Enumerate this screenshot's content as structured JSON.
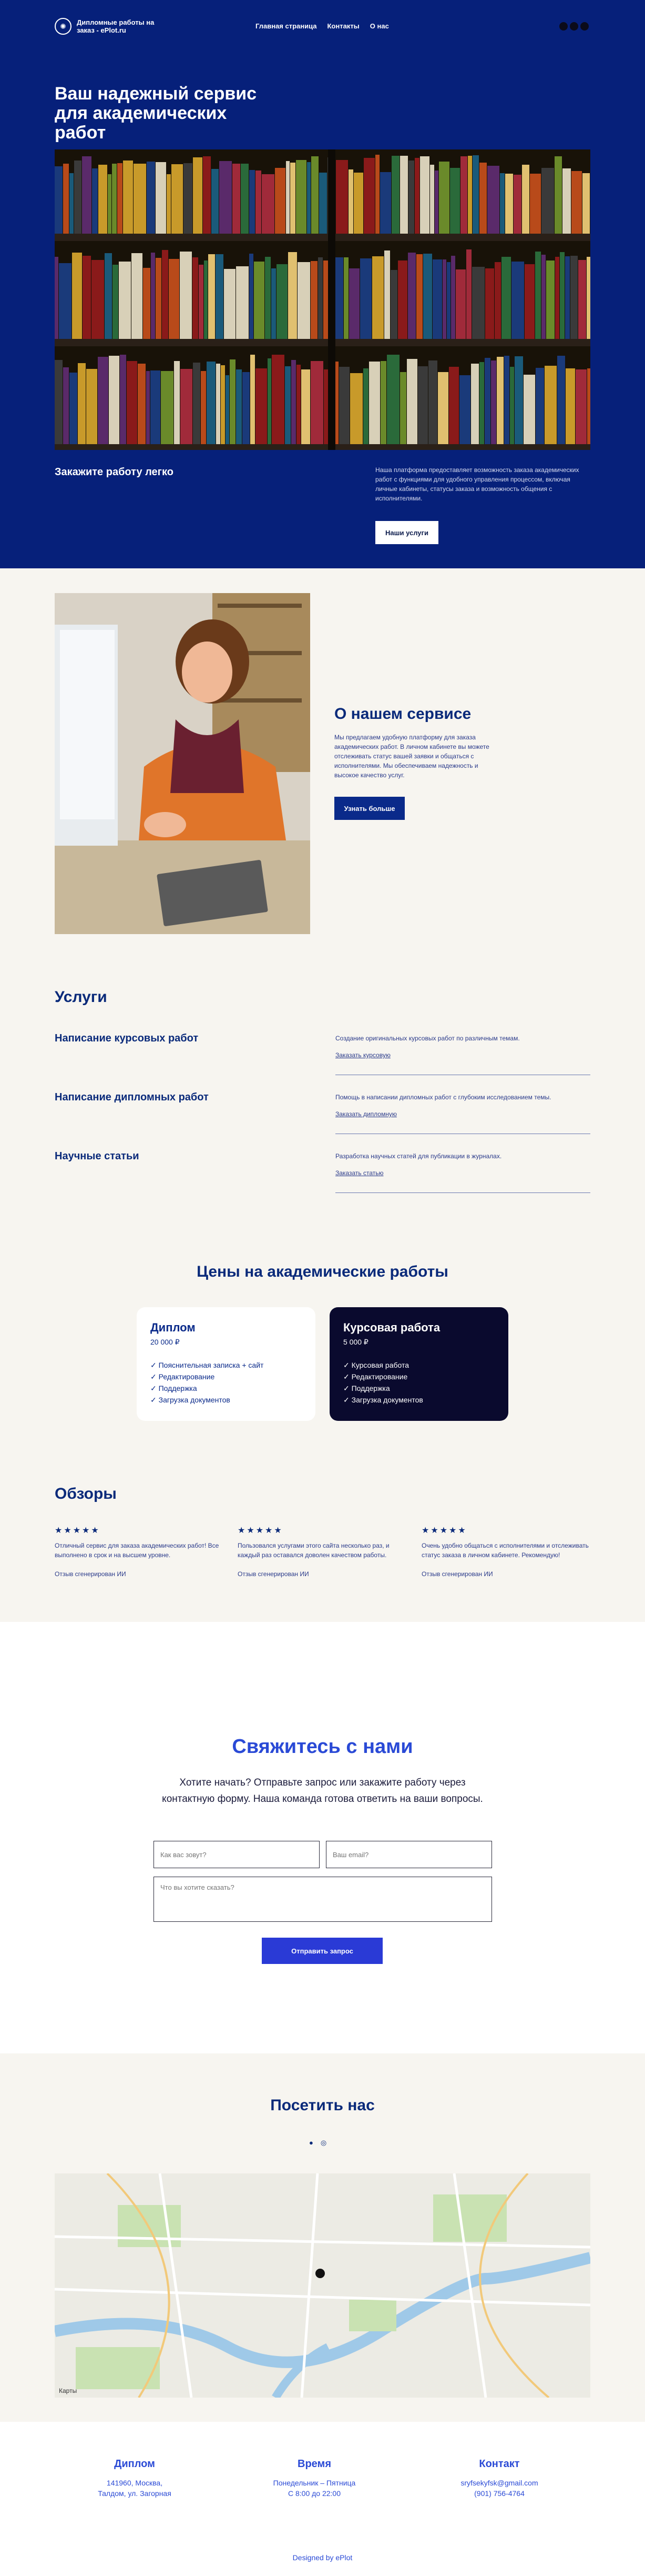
{
  "header": {
    "brand": "Дипломные работы на заказ - ePlot.ru",
    "nav": [
      "Главная страница",
      "Контакты",
      "О нас"
    ]
  },
  "hero": {
    "title": "Ваш надежный сервис для академических работ",
    "subtitle": "Закажите работу легко",
    "description": "Наша платформа предоставляет возможность заказа академических работ с функциями для удобного управления процессом, включая личные кабинеты, статусы заказа и возможность общения с исполнителями.",
    "button": "Наши услуги"
  },
  "about": {
    "title": "О нашем сервисе",
    "description": "Мы предлагаем удобную платформу для заказа академических работ. В личном кабинете вы можете отслеживать статус вашей заявки и общаться с исполнителями. Мы обеспечиваем надежность и высокое качество услуг.",
    "button": "Узнать больше"
  },
  "services": {
    "title": "Услуги",
    "items": [
      {
        "name": "Написание курсовых работ",
        "desc": "Создание оригинальных курсовых работ по различным темам.",
        "link": "Заказать курсовую"
      },
      {
        "name": "Написание дипломных работ",
        "desc": "Помощь в написании дипломных работ с глубоким исследованием темы.",
        "link": "Заказать дипломную"
      },
      {
        "name": "Научные статьи",
        "desc": "Разработка научных статей для публикации в журналах.",
        "link": "Заказать статью"
      }
    ]
  },
  "prices": {
    "title": "Цены на академические работы",
    "cards": [
      {
        "name": "Диплом",
        "price": "20 000 ₽",
        "features": [
          "✓ Пояснительная записка + сайт",
          "✓ Редактирование",
          "✓ Поддержка",
          "✓ Загрузка документов"
        ]
      },
      {
        "name": "Курсовая работа",
        "price": "5 000 ₽",
        "features": [
          "✓ Курсовая работа",
          "✓ Редактирование",
          "✓ Поддержка",
          "✓ Загрузка документов"
        ]
      }
    ]
  },
  "reviews": {
    "title": "Обзоры",
    "items": [
      {
        "stars": "★★★★★",
        "text": "Отличный сервис для заказа академических работ! Все выполнено в срок и на высшем уровне.",
        "sig": "Отзыв сгенерирован ИИ"
      },
      {
        "stars": "★★★★★",
        "text": "Пользовался услугами этого сайта несколько раз, и каждый раз оставался доволен качеством работы.",
        "sig": "Отзыв сгенерирован ИИ"
      },
      {
        "stars": "★★★★★",
        "text": "Очень удобно общаться с исполнителями и отслеживать статус заказа в личном кабинете. Рекомендую!",
        "sig": "Отзыв сгенерирован ИИ"
      }
    ]
  },
  "contact": {
    "title": "Свяжитесь с нами",
    "description": "Хотите начать? Отправьте запрос или закажите работу через контактную форму. Наша команда готова ответить на ваши вопросы.",
    "name_placeholder": "Как вас зовут?",
    "email_placeholder": "Ваш email?",
    "message_placeholder": "Что вы хотите сказать?",
    "button": "Отправить запрос"
  },
  "visit": {
    "title": "Посетить нас",
    "map_caption": "Карты"
  },
  "footer": {
    "cols": [
      {
        "title": "Диплом",
        "lines": [
          "141960, Москва,",
          "Талдом, ул. Загорная"
        ]
      },
      {
        "title": "Время",
        "lines": [
          "Понедельник – Пятница",
          "С 8:00 до 22:00"
        ]
      },
      {
        "title": "Контакт",
        "lines": [
          "sryfsekyfsk@gmail.com",
          "(901) 756-4764"
        ]
      }
    ],
    "credit": "Designed by ePlot"
  }
}
